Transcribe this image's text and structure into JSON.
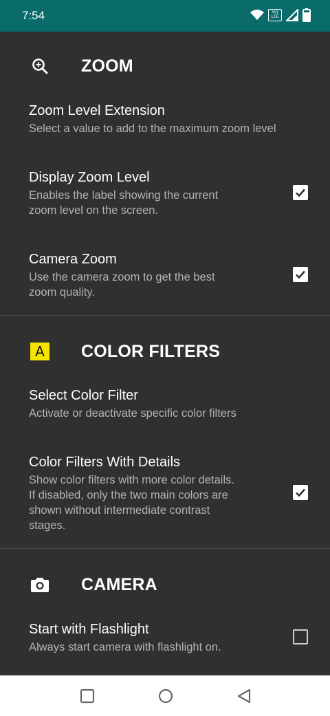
{
  "status_bar": {
    "time": "7:54",
    "icons": [
      "wifi-icon",
      "volte-icon",
      "signal-icon",
      "battery-icon"
    ],
    "volte_label": "Vo) LTE"
  },
  "sections": [
    {
      "id": "zoom",
      "icon": "zoom-in-icon",
      "title": "ZOOM",
      "prefs": [
        {
          "title": "Zoom Level Extension",
          "summary": "Select a value to add to the maximum zoom level"
        },
        {
          "title": "Display Zoom Level",
          "summary_lines": [
            "Enables the label showing the current",
            "zoom level on the screen."
          ],
          "checkbox": true
        },
        {
          "title": "Camera Zoom",
          "summary_lines": [
            "Use the camera zoom to get the best",
            "zoom quality."
          ],
          "checkbox": true
        }
      ]
    },
    {
      "id": "color-filters",
      "icon": "letter-a-icon",
      "icon_text": "A",
      "title": "COLOR FILTERS",
      "prefs": [
        {
          "title": "Select Color Filter",
          "summary": "Activate or deactivate specific color filters"
        },
        {
          "title": "Color Filters With Details",
          "summary_lines": [
            "Show color filters with more color details.",
            "If disabled, only the two main colors are",
            "shown without intermediate contrast",
            "stages."
          ],
          "checkbox": true
        }
      ]
    },
    {
      "id": "camera",
      "icon": "camera-icon",
      "title": "CAMERA",
      "prefs": [
        {
          "title": "Start with Flashlight",
          "summary": "Always start camera with flashlight on.",
          "checkbox": false
        }
      ]
    }
  ],
  "nav_bar": {
    "buttons": [
      "recents-square-icon",
      "home-circle-icon",
      "back-triangle-icon"
    ]
  },
  "colors": {
    "status_bar": "#0a6b6b",
    "background": "#303030",
    "accent_icon_bg": "#f5e400",
    "summary_text": "#b3b3b3"
  }
}
